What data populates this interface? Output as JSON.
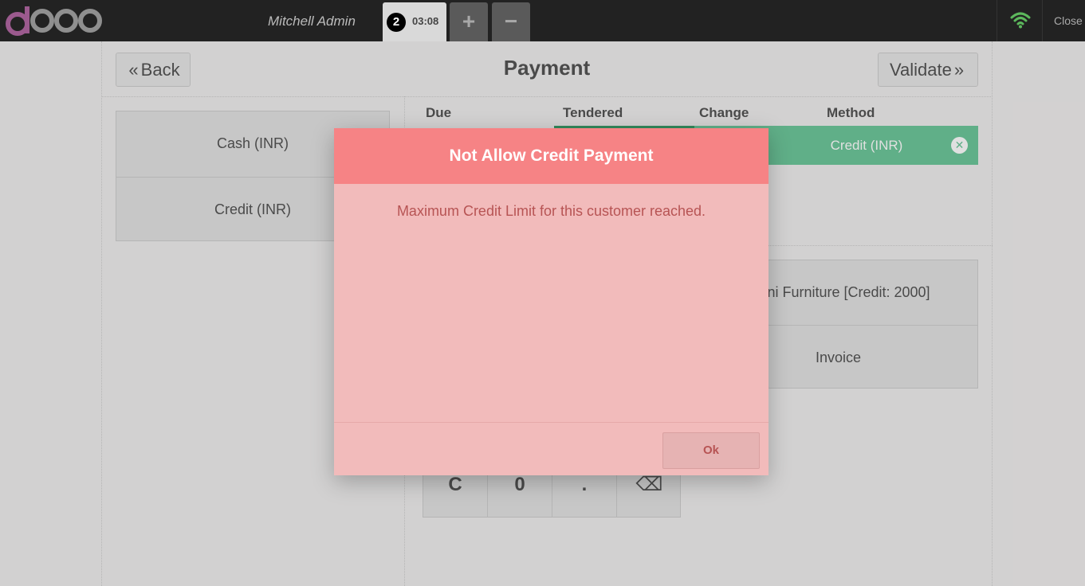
{
  "header": {
    "user": "Mitchell Admin",
    "order_number": "2",
    "order_time": "03:08",
    "add_label": "+",
    "remove_label": "−",
    "close_label": "Close",
    "wifi_color": "#5cb85c"
  },
  "payment": {
    "back_label": "Back",
    "title": "Payment",
    "validate_label": "Validate",
    "methods": [
      {
        "label": "Cash (INR)"
      },
      {
        "label": "Credit (INR)"
      }
    ],
    "columns": {
      "due": "Due",
      "tendered": "Tendered",
      "change": "Change",
      "method": "Method"
    },
    "line": {
      "method": "Credit (INR)"
    },
    "customer": {
      "name": "Shini Furniture [Credit: 2000]",
      "invoice_label": "Invoice"
    },
    "numpad_keys": [
      "C",
      "0",
      ".",
      "⌫"
    ]
  },
  "popup": {
    "title": "Not Allow Credit Payment",
    "message": "Maximum Credit Limit for this customer reached.",
    "ok_label": "Ok",
    "header_color": "#f68385",
    "body_color": "#f2bbbb"
  }
}
